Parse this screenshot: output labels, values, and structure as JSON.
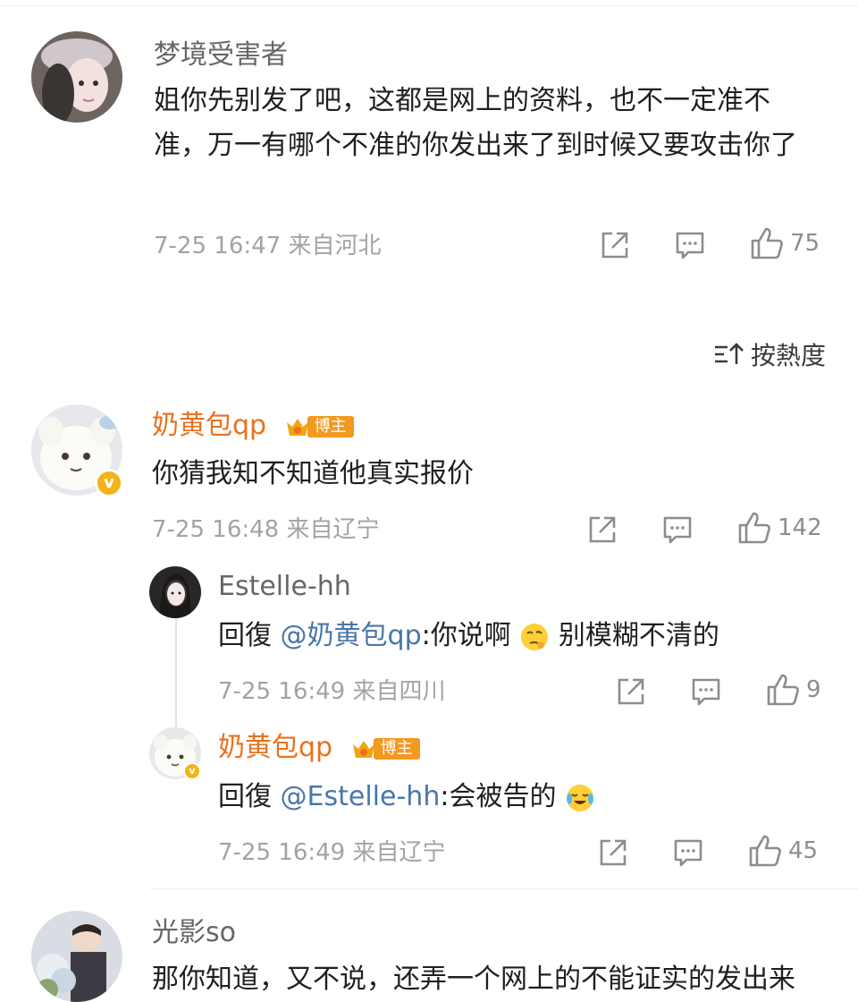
{
  "comments": [
    {
      "user": "梦境受害者",
      "text": "姐你先别发了吧，这都是网上的资料，也不一定准不准，万一有哪个不准的你发出来了到时候又要攻击你了",
      "meta": "7-25 16:47 来自河北",
      "likes": "75"
    },
    {
      "user": "奶黄包qp",
      "badge": "博主",
      "text": "你猜我知不知道他真实报价",
      "meta": "7-25 16:48 来自辽宁",
      "likes": "142",
      "replies": [
        {
          "user": "Estelle-hh",
          "prefix": "回復 ",
          "mention": "@奶黄包qp",
          "text": ":你说啊",
          "text2": " 别模糊不清的",
          "meta": "7-25 16:49 来自四川",
          "likes": "9"
        },
        {
          "user": "奶黄包qp",
          "badge": "博主",
          "prefix": "回復 ",
          "mention": "@Estelle-hh",
          "text": ":会被告的",
          "meta": "7-25 16:49 来自辽宁",
          "likes": "45"
        }
      ]
    },
    {
      "user": "光影so",
      "text": "那你知道，又不说，还弄一个网上的不能证实的发出来"
    }
  ],
  "sort": {
    "label": "按熱度"
  },
  "colors": {
    "orange_name": "#e8711e",
    "mention": "#4a76a8",
    "badge": "#f2991f"
  },
  "icons": [
    "share-icon",
    "comment-icon",
    "like-icon",
    "sort-icon",
    "crown-icon",
    "verified-icon"
  ]
}
